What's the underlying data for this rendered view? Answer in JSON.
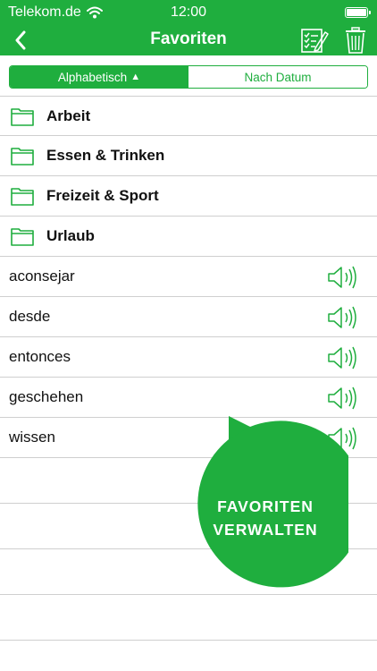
{
  "status_bar": {
    "carrier": "Telekom.de",
    "time": "12:00"
  },
  "nav": {
    "title": "Favoriten",
    "icons": [
      "back-chevron-icon",
      "edit-list-icon",
      "trash-icon"
    ]
  },
  "sort": {
    "options": [
      {
        "label": "Alphabetisch",
        "indicator": "▲",
        "selected": true
      },
      {
        "label": "Nach Datum",
        "selected": false
      }
    ]
  },
  "folders": [
    {
      "label": "Arbeit"
    },
    {
      "label": "Essen & Trinken"
    },
    {
      "label": "Freizeit & Sport"
    },
    {
      "label": "Urlaub"
    }
  ],
  "words": [
    {
      "label": "aconsejar"
    },
    {
      "label": "desde"
    },
    {
      "label": "entonces"
    },
    {
      "label": "geschehen"
    },
    {
      "label": "wissen"
    }
  ],
  "manage_bubble": {
    "line1": "FAVORITEN",
    "line2": "VERWALTEN"
  },
  "colors": {
    "accent": "#1fae3e",
    "divider": "#cfcfcf",
    "text": "#111111"
  }
}
